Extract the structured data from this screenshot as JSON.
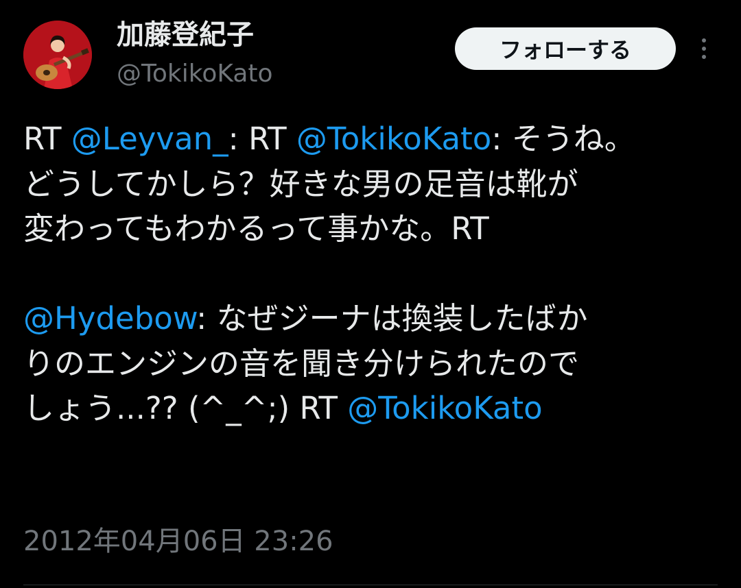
{
  "author": {
    "display_name": "加藤登紀子",
    "handle": "@TokikoKato"
  },
  "actions": {
    "follow_label": "フォローする",
    "more_icon": "more-vertical-icon"
  },
  "tweet": {
    "line1": {
      "prefix": "RT ",
      "mention1": "@Leyvan_",
      "mid": ": RT ",
      "mention2": "@TokikoKato",
      "suffix": ": そうね。"
    },
    "line2": "どうしてかしら？好きな男の足音は靴が",
    "line3": "変わってもわかるって事かな。RT",
    "line5": {
      "mention": "@Hydebow",
      "text": ": なぜジーナは換装したばか"
    },
    "line6": "りのエンジンの音を聞き分けられたので",
    "line7": {
      "text": "しょう...?? (^_^;) RT ",
      "mention": "@TokikoKato"
    }
  },
  "timestamp": "2012年04月06日 23:26",
  "colors": {
    "background": "#000000",
    "text": "#e7e9ea",
    "secondary": "#71767b",
    "link": "#1d9bf0",
    "button_bg": "#eff3f4"
  }
}
